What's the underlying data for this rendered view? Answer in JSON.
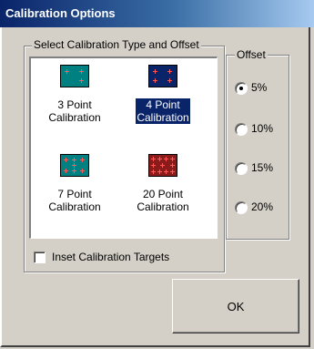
{
  "window": {
    "title": "Calibration Options"
  },
  "type_group": {
    "legend": "Select Calibration Type and Offset",
    "options": [
      {
        "label": "3 Point\nCalibration",
        "icon": "3-point-icon",
        "selected": false,
        "icon_bg": "#008080",
        "icon_border": "#000000"
      },
      {
        "label": "4 Point\nCalibration",
        "icon": "4-point-icon",
        "selected": true,
        "icon_bg": "#0a246a",
        "icon_border": "#000000"
      },
      {
        "label": "7 Point\nCalibration",
        "icon": "7-point-icon",
        "selected": false,
        "icon_bg": "#008080",
        "icon_border": "#000000"
      },
      {
        "label": "20 Point\nCalibration",
        "icon": "20-point-icon",
        "selected": false,
        "icon_bg": "#8b1a1a",
        "icon_border": "#000000"
      }
    ]
  },
  "offset_group": {
    "legend": "Offset",
    "options": [
      {
        "label": "5%",
        "checked": true
      },
      {
        "label": "10%",
        "checked": false
      },
      {
        "label": "15%",
        "checked": false
      },
      {
        "label": "20%",
        "checked": false
      }
    ]
  },
  "inset_checkbox": {
    "label": "Inset Calibration Targets",
    "checked": false
  },
  "ok_button": {
    "label": "OK"
  },
  "colors": {
    "face": "#d4d0c8",
    "title_start": "#0a246a",
    "title_end": "#a6caf0",
    "selection": "#0a246a",
    "target_marker": "#ff5a5a"
  }
}
